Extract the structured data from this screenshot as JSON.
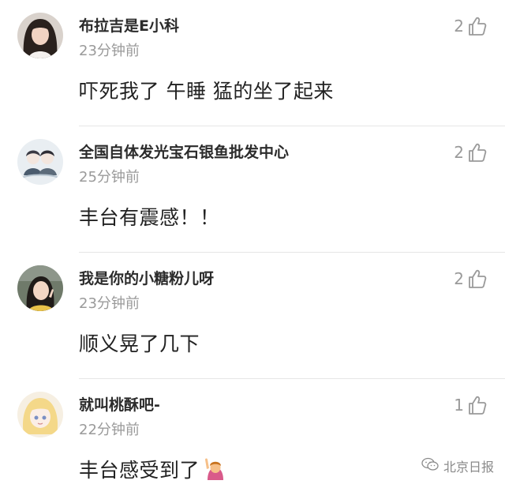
{
  "comments": [
    {
      "username": "布拉吉是E小科",
      "time": "23分钟前",
      "text": "吓死我了 午睡 猛的坐了起来",
      "likes": "2",
      "avatar_icon": "avatar-girl-long-hair"
    },
    {
      "username": "全国自体发光宝石银鱼批发中心",
      "time": "25分钟前",
      "text": "丰台有震感！！",
      "likes": "2",
      "avatar_icon": "avatar-two-anime-boys"
    },
    {
      "username": "我是你的小糖粉儿呀",
      "time": "23分钟前",
      "text": "顺义晃了几下",
      "likes": "2",
      "avatar_icon": "avatar-girl-peace-sign"
    },
    {
      "username": "就叫桃酥吧-",
      "time": "22分钟前",
      "text": "丰台感受到了",
      "likes": "1",
      "avatar_icon": "avatar-anime-blonde-girl",
      "emoji": "person-raising-hand-emoji"
    }
  ],
  "like_icon": "thumbs-up-outline-icon",
  "watermark": {
    "text": "北京日报",
    "icon": "wechat-official-account-icon"
  }
}
